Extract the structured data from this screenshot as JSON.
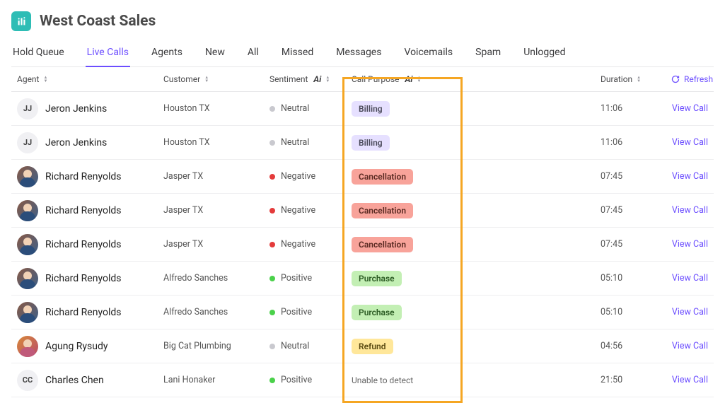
{
  "header": {
    "title": "West Coast Sales"
  },
  "tabs": [
    {
      "label": "Hold Queue",
      "active": false
    },
    {
      "label": "Live Calls",
      "active": true
    },
    {
      "label": "Agents",
      "active": false
    },
    {
      "label": "New",
      "active": false
    },
    {
      "label": "All",
      "active": false
    },
    {
      "label": "Missed",
      "active": false
    },
    {
      "label": "Messages",
      "active": false
    },
    {
      "label": "Voicemails",
      "active": false
    },
    {
      "label": "Spam",
      "active": false
    },
    {
      "label": "Unlogged",
      "active": false
    }
  ],
  "columns": {
    "agent": "Agent",
    "customer": "Customer",
    "sentiment": "Sentiment",
    "purpose": "Call Purpose",
    "duration": "Duration",
    "refresh": "Refresh"
  },
  "rows": [
    {
      "avatar_type": "initials",
      "avatar_label": "JJ",
      "agent": "Jeron Jenkins",
      "customer": "Houston TX",
      "sentiment": "Neutral",
      "sentiment_class": "neutral",
      "purpose": "Billing",
      "purpose_class": "billing",
      "duration": "11:06",
      "action": "View Call"
    },
    {
      "avatar_type": "initials",
      "avatar_label": "JJ",
      "agent": "Jeron Jenkins",
      "customer": "Houston TX",
      "sentiment": "Neutral",
      "sentiment_class": "neutral",
      "purpose": "Billing",
      "purpose_class": "billing",
      "duration": "11:06",
      "action": "View Call"
    },
    {
      "avatar_type": "img",
      "avatar_label": "",
      "agent": "Richard Renyolds",
      "customer": "Jasper TX",
      "sentiment": "Negative",
      "sentiment_class": "negative",
      "purpose": "Cancellation",
      "purpose_class": "cancellation",
      "duration": "07:45",
      "action": "View Call"
    },
    {
      "avatar_type": "img",
      "avatar_label": "",
      "agent": "Richard Renyolds",
      "customer": "Jasper TX",
      "sentiment": "Negative",
      "sentiment_class": "negative",
      "purpose": "Cancellation",
      "purpose_class": "cancellation",
      "duration": "07:45",
      "action": "View Call"
    },
    {
      "avatar_type": "img",
      "avatar_label": "",
      "agent": "Richard Renyolds",
      "customer": "Jasper TX",
      "sentiment": "Negative",
      "sentiment_class": "negative",
      "purpose": "Cancellation",
      "purpose_class": "cancellation",
      "duration": "07:45",
      "action": "View Call"
    },
    {
      "avatar_type": "img",
      "avatar_label": "",
      "agent": "Richard Renyolds",
      "customer": "Alfredo Sanches",
      "sentiment": "Positive",
      "sentiment_class": "positive",
      "purpose": "Purchase",
      "purpose_class": "purchase",
      "duration": "05:10",
      "action": "View Call"
    },
    {
      "avatar_type": "img",
      "avatar_label": "",
      "agent": "Richard Renyolds",
      "customer": "Alfredo Sanches",
      "sentiment": "Positive",
      "sentiment_class": "positive",
      "purpose": "Purchase",
      "purpose_class": "purchase",
      "duration": "05:10",
      "action": "View Call"
    },
    {
      "avatar_type": "img2",
      "avatar_label": "",
      "agent": "Agung Rysudy",
      "customer": "Big Cat Plumbing",
      "sentiment": "Neutral",
      "sentiment_class": "neutral",
      "purpose": "Refund",
      "purpose_class": "refund",
      "duration": "04:56",
      "action": "View Call"
    },
    {
      "avatar_type": "initials",
      "avatar_label": "CC",
      "agent": "Charles Chen",
      "customer": "Lani Honaker",
      "sentiment": "Positive",
      "sentiment_class": "positive",
      "purpose": "Unable to detect",
      "purpose_class": "none",
      "duration": "21:50",
      "action": "View Call"
    }
  ]
}
